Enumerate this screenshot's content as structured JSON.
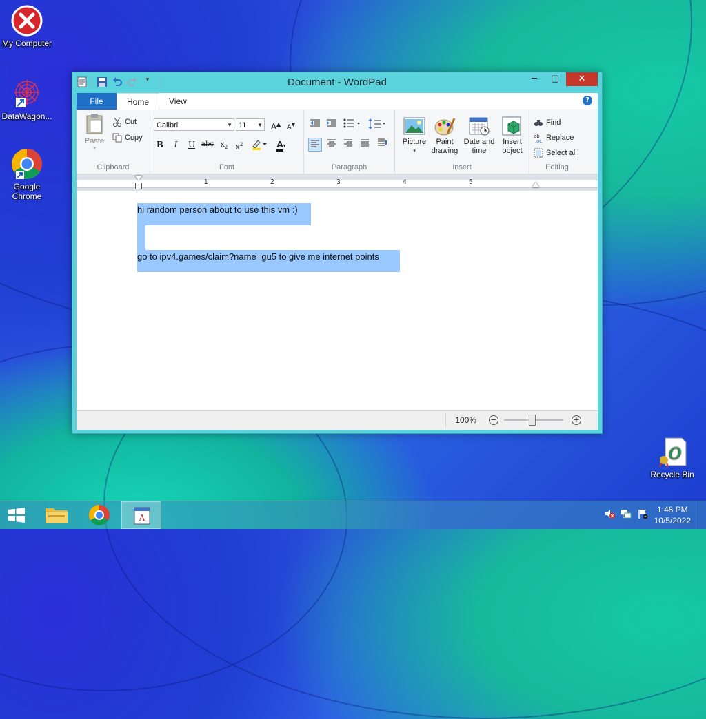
{
  "desktop": {
    "icons": [
      {
        "label": "My Computer"
      },
      {
        "label": "DataWagon..."
      },
      {
        "label": "Google Chrome"
      },
      {
        "label": "Recycle Bin"
      }
    ]
  },
  "window": {
    "title": "Document - WordPad",
    "controls": {
      "minimize": "─",
      "maximize": "□",
      "close": "✕"
    }
  },
  "ribbon": {
    "tabs": {
      "file": "File",
      "home": "Home",
      "view": "View"
    },
    "clipboard": {
      "paste": "Paste",
      "cut": "Cut",
      "copy": "Copy",
      "label": "Clipboard"
    },
    "font": {
      "family": "Calibri",
      "size": "11",
      "label": "Font"
    },
    "paragraph": {
      "label": "Paragraph"
    },
    "insert": {
      "picture": "Picture",
      "paint_line1": "Paint",
      "paint_line2": "drawing",
      "date_line1": "Date and",
      "date_line2": "time",
      "object_line1": "Insert",
      "object_line2": "object",
      "label": "Insert"
    },
    "editing": {
      "find": "Find",
      "replace": "Replace",
      "select_all": "Select all",
      "label": "Editing"
    }
  },
  "ruler": {
    "numbers": [
      "1",
      "2",
      "3",
      "4",
      "5"
    ]
  },
  "document": {
    "lines": [
      "hi random person about to use this vm :)",
      "",
      "go to ipv4.games/claim?name=gu5 to give me internet points"
    ]
  },
  "statusbar": {
    "zoom": "100%"
  },
  "taskbar": {
    "time": "1:48 PM",
    "date": "10/5/2022"
  },
  "colors": {
    "accent": "#1e6fc5",
    "selection": "#99c9ff",
    "close": "#c7372a"
  }
}
